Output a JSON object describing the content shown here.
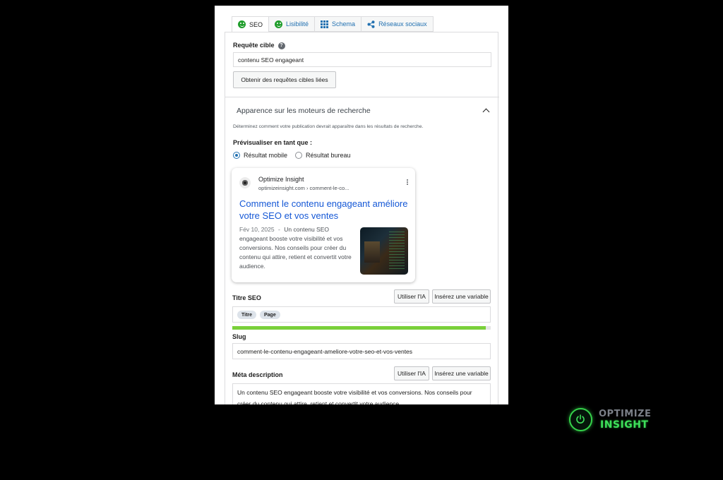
{
  "tabs": [
    {
      "label": "SEO",
      "icon": "smiley-icon",
      "active": true
    },
    {
      "label": "Lisibilité",
      "icon": "smiley-icon",
      "active": false
    },
    {
      "label": "Schema",
      "icon": "grid-icon",
      "active": false
    },
    {
      "label": "Réseaux sociaux",
      "icon": "share-icon",
      "active": false
    }
  ],
  "focus": {
    "label": "Requête cible",
    "value": "contenu SEO engageant",
    "related_button": "Obtenir des requêtes cibles liées"
  },
  "appearance": {
    "title": "Apparence sur les moteurs de recherche",
    "description": "Déterminez comment votre publication devrait apparaître dans les résultats de recherche.",
    "preview_label": "Prévisualiser en tant que :",
    "mobile_label": "Résultat mobile",
    "desktop_label": "Résultat bureau",
    "selected": "mobile"
  },
  "preview": {
    "site_name": "Optimize Insight",
    "url_domain": "optimizeinsight.com",
    "url_path": "comment-le-co...",
    "title": "Comment le contenu engageant améliore votre SEO et vos ventes",
    "date": "Fév 10, 2025",
    "separator": "-",
    "description": "Un contenu SEO engageant booste votre visibilité et vos conversions. Nos conseils pour créer du contenu qui attire, retient et convertit votre audience."
  },
  "seo_title": {
    "label": "Titre SEO",
    "ai_button": "Utiliser l'IA",
    "variable_button": "Insérez une variable",
    "pills": [
      "Titre",
      "Page"
    ],
    "progress": 0.98
  },
  "slug": {
    "label": "Slug",
    "value": "comment-le-contenu-engageant-ameliore-votre-seo-et-vos-ventes"
  },
  "meta": {
    "label": "Méta description",
    "ai_button": "Utiliser l'IA",
    "variable_button": "Insérez une variable",
    "value": "Un contenu SEO engageant booste votre visibilité et vos conversions. Nos conseils pour créer du contenu qui attire, retient et convertit votre audience."
  },
  "logo": {
    "line1": "OPTIMIZE",
    "line2": "INSIGHT",
    "icon": "power-icon"
  },
  "colors": {
    "link": "#2271b1",
    "serp_title": "#1558d6",
    "progress": "#7ad03a",
    "brand_green": "#3ee05a"
  }
}
